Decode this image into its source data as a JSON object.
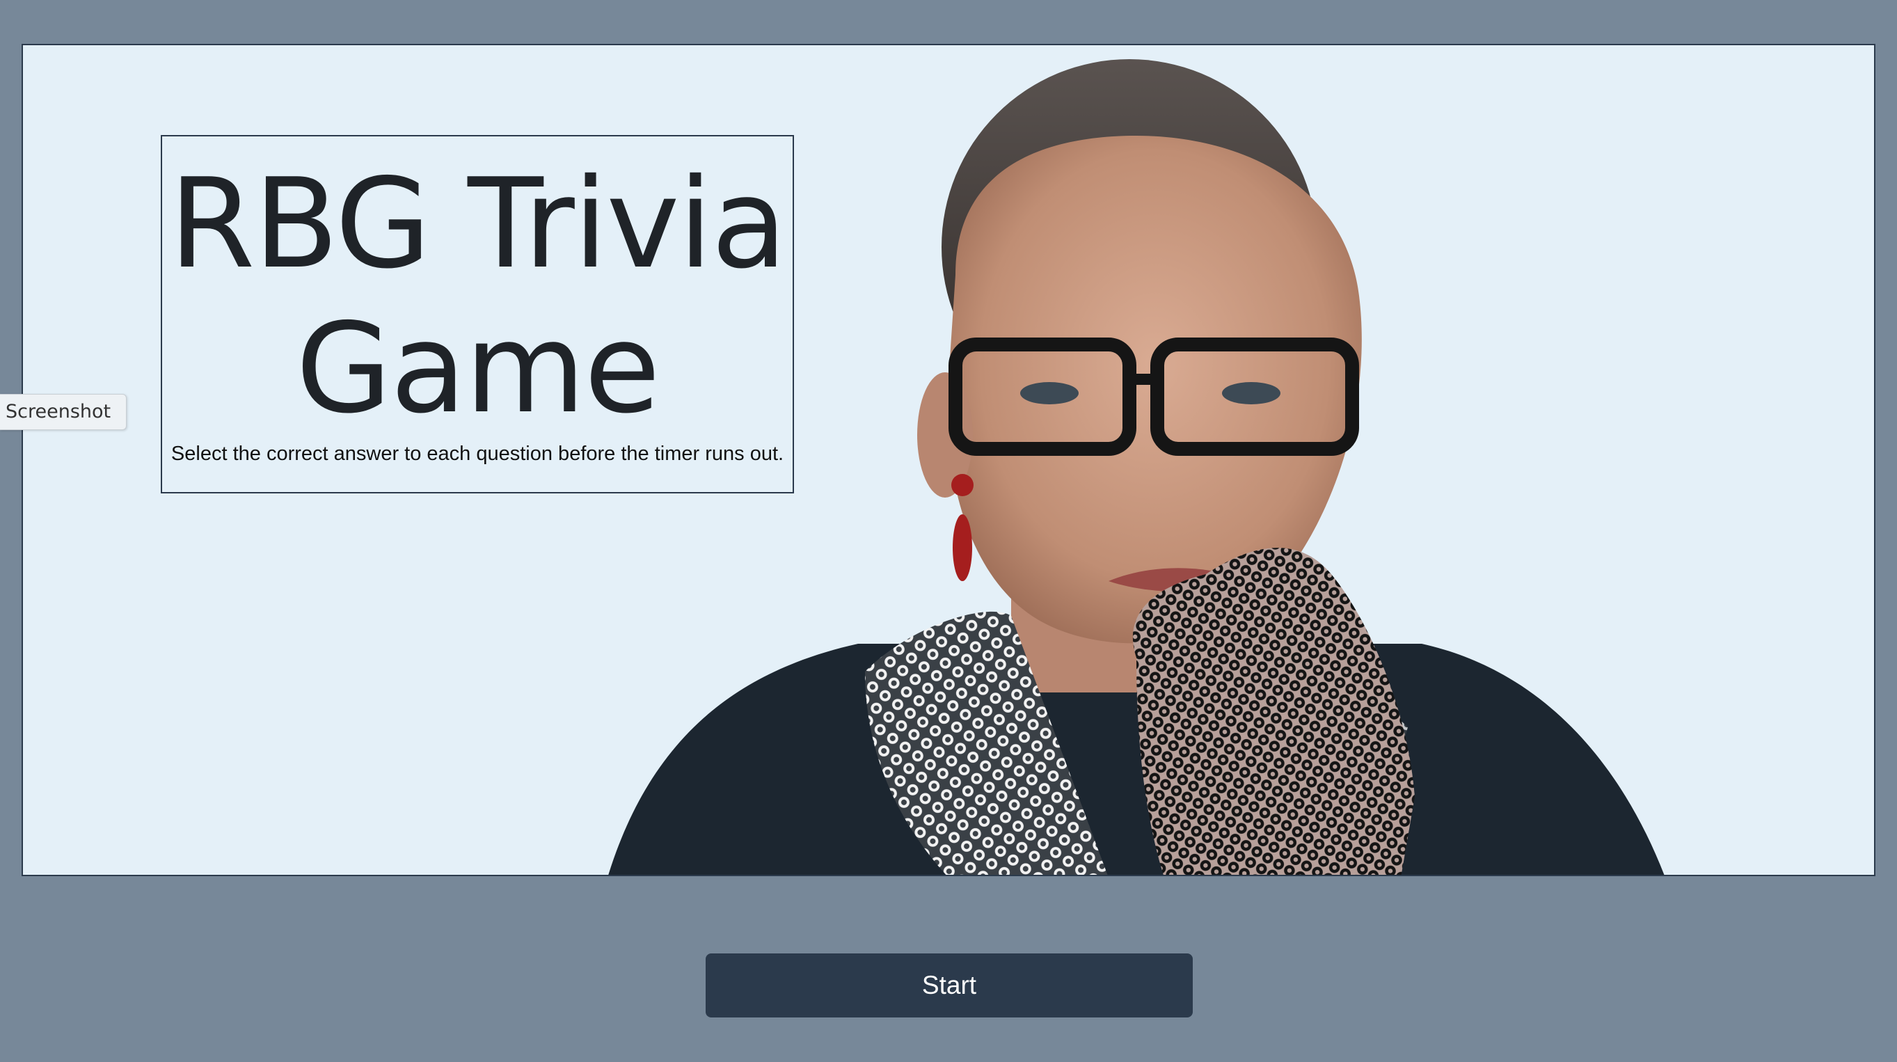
{
  "app": {
    "title": "RBG Trivia Game",
    "description": "Select the correct answer to each question before the timer runs out."
  },
  "side_tab": {
    "label": "Screenshot"
  },
  "controls": {
    "start_label": "Start"
  },
  "colors": {
    "page_background": "#778899",
    "hero_background": "#e4f0f8",
    "button_background": "#2b3a4c",
    "button_text": "#ffffff",
    "title_text": "#1f2328"
  },
  "image": {
    "subject": "portrait-photo"
  }
}
